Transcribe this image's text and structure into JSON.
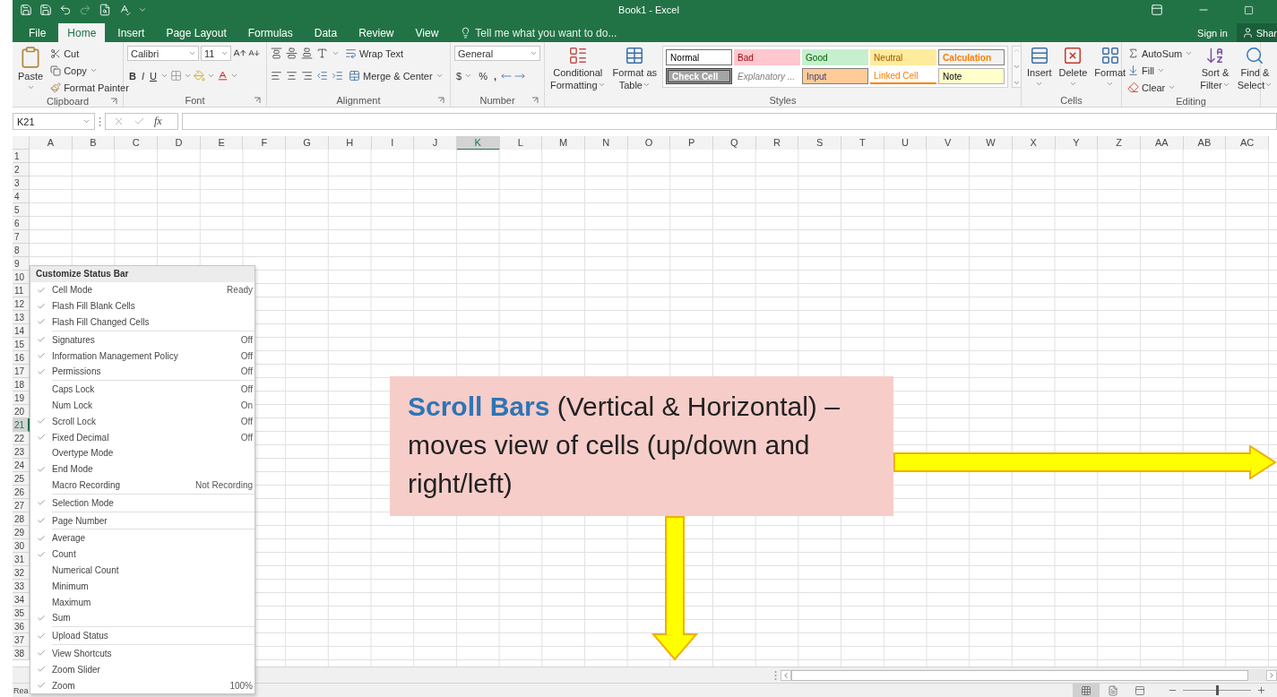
{
  "window": {
    "title": "Book1 - Excel"
  },
  "tabs": [
    {
      "label": "File",
      "selected": false
    },
    {
      "label": "Home",
      "selected": true
    },
    {
      "label": "Insert",
      "selected": false
    },
    {
      "label": "Page Layout",
      "selected": false
    },
    {
      "label": "Formulas",
      "selected": false
    },
    {
      "label": "Data",
      "selected": false
    },
    {
      "label": "Review",
      "selected": false
    },
    {
      "label": "View",
      "selected": false
    }
  ],
  "tell_me": "Tell me what you want to do...",
  "sign_in": "Sign in",
  "share": "Shar",
  "ribbon": {
    "clipboard": {
      "label": "Clipboard",
      "paste": "Paste",
      "cut": "Cut",
      "copy": "Copy",
      "painter": "Format Painter"
    },
    "font": {
      "label": "Font",
      "name": "Calibri",
      "size": "11",
      "bold": "B",
      "italic": "I",
      "underline": "U"
    },
    "alignment": {
      "label": "Alignment",
      "wrap": "Wrap Text",
      "merge": "Merge & Center"
    },
    "number": {
      "label": "Number",
      "format": "General",
      "currency": "$",
      "percent": "%",
      "comma": ","
    },
    "styles": {
      "label": "Styles",
      "conditional": [
        "Conditional",
        "Formatting"
      ],
      "table": [
        "Format as",
        "Table"
      ],
      "gallery": [
        {
          "label": "Normal",
          "kind": "normal"
        },
        {
          "label": "Bad",
          "kind": "bad"
        },
        {
          "label": "Good",
          "kind": "good"
        },
        {
          "label": "Neutral",
          "kind": "neutral"
        },
        {
          "label": "Calculation",
          "kind": "calculation"
        },
        {
          "label": "Check Cell",
          "kind": "check"
        },
        {
          "label": "Explanatory ...",
          "kind": "explanatory"
        },
        {
          "label": "Input",
          "kind": "input"
        },
        {
          "label": "Linked Cell",
          "kind": "linked"
        },
        {
          "label": "Note",
          "kind": "note"
        }
      ]
    },
    "cells": {
      "label": "Cells",
      "actions": [
        "Insert",
        "Delete",
        "Format"
      ]
    },
    "editing": {
      "label": "Editing",
      "autosum": "AutoSum",
      "fill": "Fill",
      "clear": "Clear",
      "sort": [
        "Sort &",
        "Filter"
      ],
      "find": [
        "Find &",
        "Select"
      ]
    }
  },
  "formula_bar": {
    "name_box": "K21",
    "fx": "fx"
  },
  "columns": [
    {
      "label": "A",
      "selected": false
    },
    {
      "label": "B",
      "selected": false
    },
    {
      "label": "C",
      "selected": false
    },
    {
      "label": "D",
      "selected": false
    },
    {
      "label": "E",
      "selected": false
    },
    {
      "label": "F",
      "selected": false
    },
    {
      "label": "G",
      "selected": false
    },
    {
      "label": "H",
      "selected": false
    },
    {
      "label": "I",
      "selected": false
    },
    {
      "label": "J",
      "selected": false
    },
    {
      "label": "K",
      "selected": true
    },
    {
      "label": "L",
      "selected": false
    },
    {
      "label": "M",
      "selected": false
    },
    {
      "label": "N",
      "selected": false
    },
    {
      "label": "O",
      "selected": false
    },
    {
      "label": "P",
      "selected": false
    },
    {
      "label": "Q",
      "selected": false
    },
    {
      "label": "R",
      "selected": false
    },
    {
      "label": "S",
      "selected": false
    },
    {
      "label": "T",
      "selected": false
    },
    {
      "label": "U",
      "selected": false
    },
    {
      "label": "V",
      "selected": false
    },
    {
      "label": "W",
      "selected": false
    },
    {
      "label": "X",
      "selected": false
    },
    {
      "label": "Y",
      "selected": false
    },
    {
      "label": "Z",
      "selected": false
    },
    {
      "label": "AA",
      "selected": false
    },
    {
      "label": "AB",
      "selected": false
    },
    {
      "label": "AC",
      "selected": false
    }
  ],
  "rows": [
    {
      "label": "1",
      "selected": false
    },
    {
      "label": "2",
      "selected": false
    },
    {
      "label": "3",
      "selected": false
    },
    {
      "label": "4",
      "selected": false
    },
    {
      "label": "5",
      "selected": false
    },
    {
      "label": "6",
      "selected": false
    },
    {
      "label": "7",
      "selected": false
    },
    {
      "label": "8",
      "selected": false
    },
    {
      "label": "9",
      "selected": false
    },
    {
      "label": "10",
      "selected": false
    },
    {
      "label": "11",
      "selected": false
    },
    {
      "label": "12",
      "selected": false
    },
    {
      "label": "13",
      "selected": false
    },
    {
      "label": "14",
      "selected": false
    },
    {
      "label": "15",
      "selected": false
    },
    {
      "label": "16",
      "selected": false
    },
    {
      "label": "17",
      "selected": false
    },
    {
      "label": "18",
      "selected": false
    },
    {
      "label": "19",
      "selected": false
    },
    {
      "label": "20",
      "selected": false
    },
    {
      "label": "21",
      "selected": true
    },
    {
      "label": "22",
      "selected": false
    },
    {
      "label": "23",
      "selected": false
    },
    {
      "label": "24",
      "selected": false
    },
    {
      "label": "25",
      "selected": false
    },
    {
      "label": "26",
      "selected": false
    },
    {
      "label": "27",
      "selected": false
    },
    {
      "label": "28",
      "selected": false
    },
    {
      "label": "29",
      "selected": false
    },
    {
      "label": "30",
      "selected": false
    },
    {
      "label": "31",
      "selected": false
    },
    {
      "label": "32",
      "selected": false
    },
    {
      "label": "33",
      "selected": false
    },
    {
      "label": "34",
      "selected": false
    },
    {
      "label": "35",
      "selected": false
    },
    {
      "label": "36",
      "selected": false
    },
    {
      "label": "37",
      "selected": false
    },
    {
      "label": "38",
      "selected": false
    }
  ],
  "status_menu": {
    "title": "Customize Status Bar",
    "sections": [
      [
        {
          "label": "Cell Mode",
          "checked": true,
          "value": "Ready"
        },
        {
          "label": "Flash Fill Blank Cells",
          "checked": true
        },
        {
          "label": "Flash Fill Changed Cells",
          "checked": true
        }
      ],
      [
        {
          "label": "Signatures",
          "checked": true,
          "value": "Off"
        },
        {
          "label": "Information Management Policy",
          "checked": true,
          "value": "Off"
        },
        {
          "label": "Permissions",
          "checked": true,
          "value": "Off"
        }
      ],
      [
        {
          "label": "Caps Lock",
          "checked": false,
          "value": "Off"
        },
        {
          "label": "Num Lock",
          "checked": false,
          "value": "On"
        },
        {
          "label": "Scroll Lock",
          "checked": true,
          "value": "Off"
        },
        {
          "label": "Fixed Decimal",
          "checked": true,
          "value": "Off"
        },
        {
          "label": "Overtype Mode",
          "checked": false
        },
        {
          "label": "End Mode",
          "checked": true
        },
        {
          "label": "Macro Recording",
          "checked": false,
          "value": "Not Recording"
        }
      ],
      [
        {
          "label": "Selection Mode",
          "checked": true
        }
      ],
      [
        {
          "label": "Page Number",
          "checked": true
        }
      ],
      [
        {
          "label": "Average",
          "checked": true
        },
        {
          "label": "Count",
          "checked": true
        },
        {
          "label": "Numerical Count",
          "checked": false
        },
        {
          "label": "Minimum",
          "checked": false
        },
        {
          "label": "Maximum",
          "checked": false
        },
        {
          "label": "Sum",
          "checked": true
        }
      ],
      [
        {
          "label": "Upload Status",
          "checked": true
        }
      ],
      [
        {
          "label": "View Shortcuts",
          "checked": true
        },
        {
          "label": "Zoom Slider",
          "checked": true
        },
        {
          "label": "Zoom",
          "checked": true,
          "value": "100%"
        }
      ]
    ]
  },
  "status_bar": {
    "text": "Rea",
    "views": [
      {
        "kind": "normal",
        "selected": true
      },
      {
        "kind": "page_layout",
        "selected": false
      },
      {
        "kind": "page_break",
        "selected": false
      }
    ],
    "zoom": {
      "level": 0.5
    }
  },
  "annotation": {
    "text": "**Scroll Bars** (Vertical & Horizontal) – moves view of cells (up/down and right/left)"
  }
}
